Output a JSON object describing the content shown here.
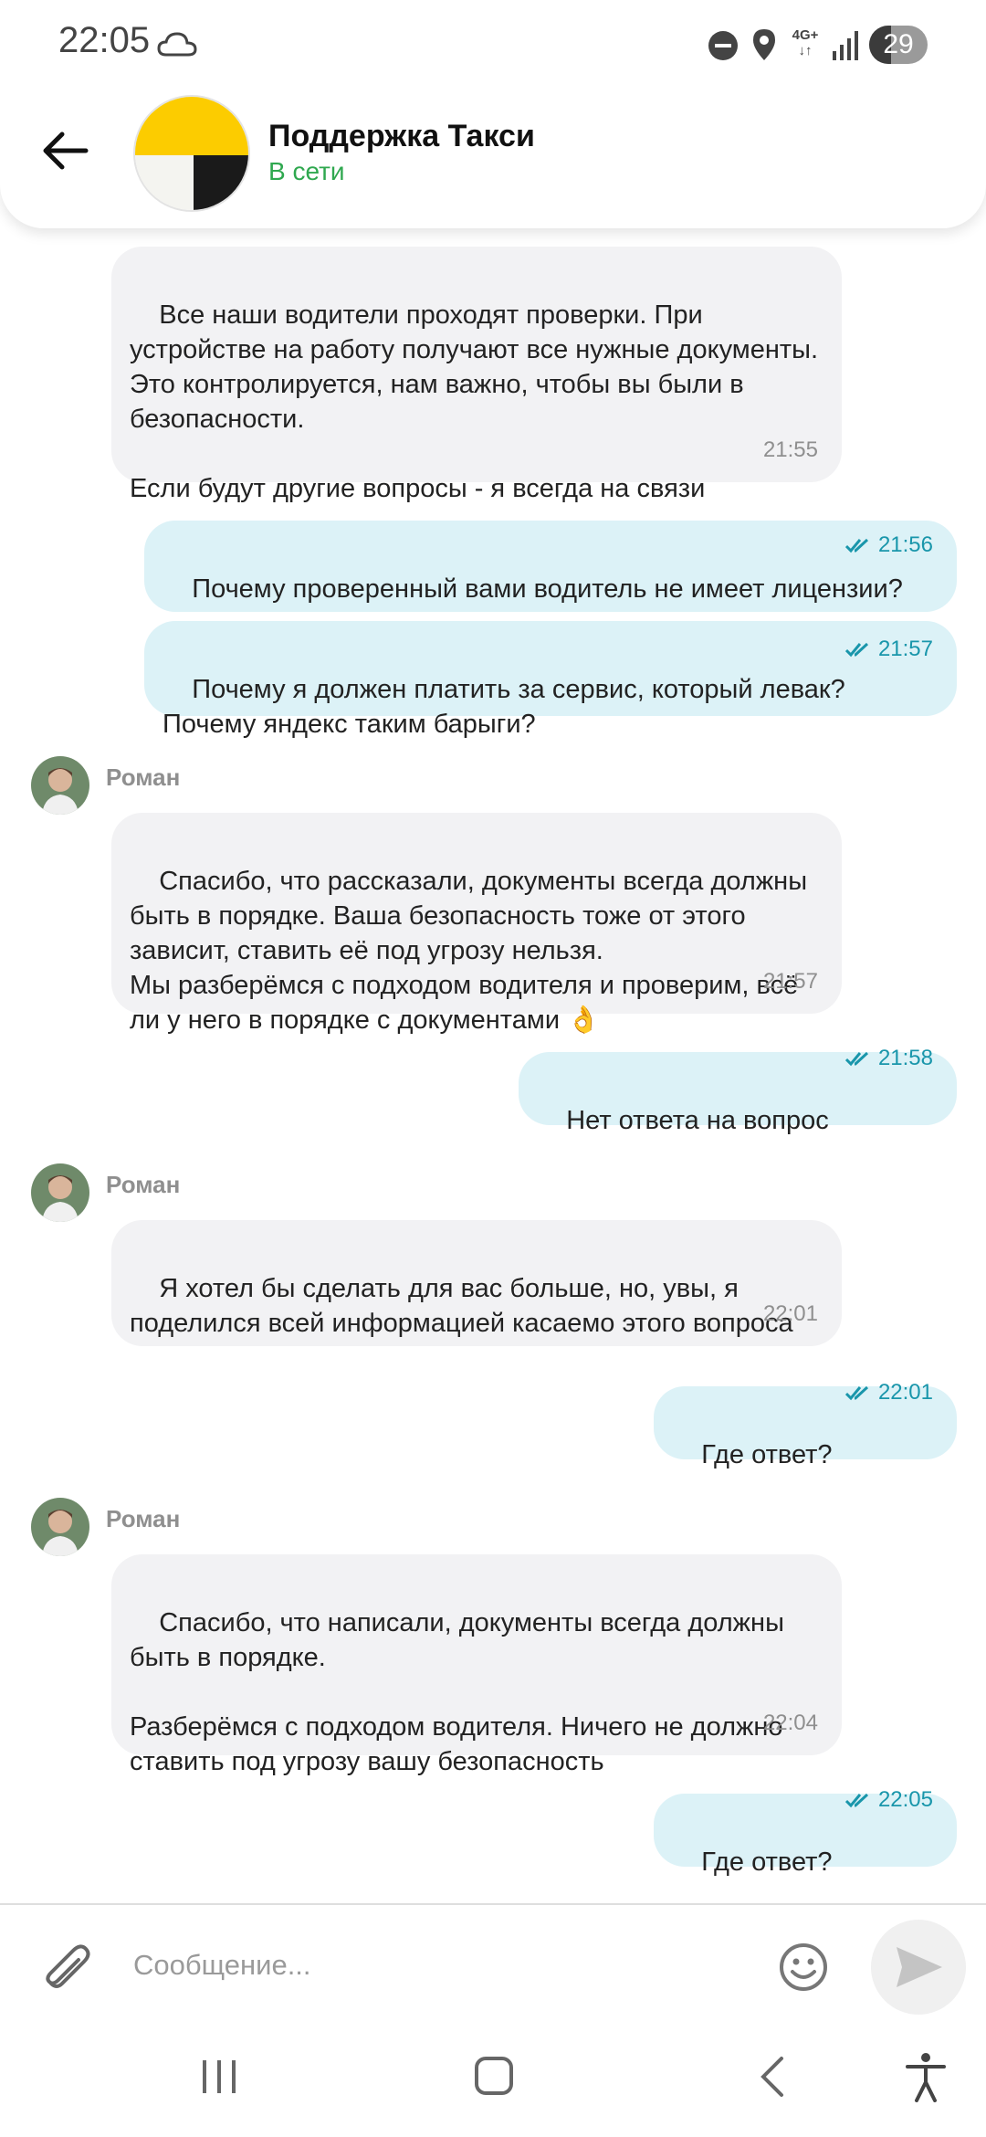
{
  "status_bar": {
    "time": "22:05",
    "network": "4G+",
    "battery": "29",
    "icons": [
      "cloud-icon",
      "do-not-disturb-icon",
      "location-icon",
      "network-4g-icon",
      "signal-icon",
      "battery-icon"
    ]
  },
  "header": {
    "title": "Поддержка Такси",
    "status": "В сети",
    "status_color": "#2fa84f"
  },
  "colors": {
    "incoming_bubble": "#f2f2f4",
    "outgoing_bubble": "#dcf2f7",
    "outgoing_time": "#1996ab"
  },
  "messages": [
    {
      "direction": "in",
      "text": "Все наши водители проходят проверки. При устройстве на работу получают все нужные документы. Это контролируется, нам важно, чтобы вы были в безопасности.\n\nЕсли будут другие вопросы - я всегда на связи",
      "time": "21:55"
    },
    {
      "direction": "out",
      "text": "Почему проверенный вами водитель не имеет лицензии?",
      "time": "21:56"
    },
    {
      "direction": "out",
      "text": "Почему я должен платить за сервис, который левак? Почему яндекс таким барыги?",
      "time": "21:57"
    },
    {
      "direction": "in",
      "sender": "Роман",
      "text": "Спасибо, что рассказали, документы всегда должны быть в порядке. Ваша безопасность тоже от этого зависит, ставить её под угрозу нельзя.\nМы разберёмся с подходом водителя и проверим, всё ли у него в порядке с документами 👌",
      "time": "21:57"
    },
    {
      "direction": "out",
      "text": "Нет ответа на вопрос",
      "time": "21:58"
    },
    {
      "direction": "in",
      "sender": "Роман",
      "text": "Я хотел бы сделать для вас больше, но, увы, я поделился всей информацией касаемо этого вопроса",
      "time": "22:01"
    },
    {
      "direction": "out",
      "text": "Где ответ?",
      "time": "22:01"
    },
    {
      "direction": "in",
      "sender": "Роман",
      "text": "Спасибо, что написали, документы всегда должны быть в порядке.\n\nРазберёмся с подходом водителя. Ничего не должно ставить под угрозу вашу безопасность",
      "time": "22:04"
    },
    {
      "direction": "out",
      "text": "Где ответ?",
      "time": "22:05"
    }
  ],
  "composer": {
    "placeholder": "Сообщение..."
  }
}
